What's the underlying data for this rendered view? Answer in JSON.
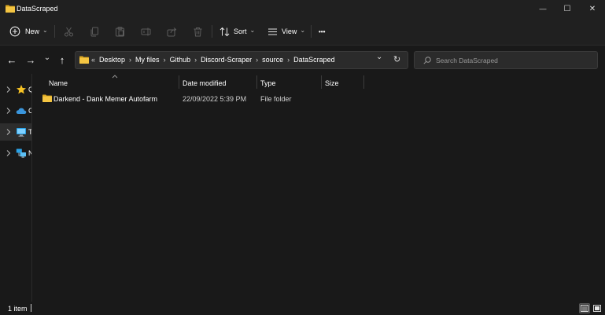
{
  "window": {
    "title": "DataScraped",
    "minimize_glyph": "—",
    "maximize_glyph": "☐",
    "close_glyph": "✕"
  },
  "toolbar": {
    "new_label": "New",
    "sort_label": "Sort",
    "view_label": "View",
    "more_glyph": "•••",
    "chevron_glyph": "⌄"
  },
  "nav": {
    "back_glyph": "←",
    "forward_glyph": "→",
    "recent_glyph": "⌄",
    "up_glyph": "↑"
  },
  "address": {
    "overflow_glyph": "«",
    "crumbs": [
      "Desktop",
      "My files",
      "Github",
      "Discord-Scraper",
      "source",
      "DataScraped"
    ],
    "sep_glyph": "›",
    "dropdown_glyph": "⌄",
    "refresh_glyph": "↻"
  },
  "search": {
    "placeholder": "Search DataScraped"
  },
  "sidebar": {
    "items": [
      {
        "icon": "star-icon",
        "label": "Q",
        "selected": false
      },
      {
        "icon": "cloud-icon",
        "label": "C",
        "selected": false
      },
      {
        "icon": "monitor-icon",
        "label": "T",
        "selected": true
      },
      {
        "icon": "network-icon",
        "label": "N",
        "selected": false
      }
    ]
  },
  "columns": {
    "name": "Name",
    "date": "Date modified",
    "type": "Type",
    "size": "Size"
  },
  "files": [
    {
      "name": "Darkend - Dank Memer Autofarm",
      "date": "22/09/2022 5:39 PM",
      "type": "File folder",
      "size": ""
    }
  ],
  "status": {
    "item_count": "1 item"
  },
  "colors": {
    "folder": "#f4c542",
    "folder_dark": "#d9a520",
    "accent": "#60cdff",
    "star": "#f7c325",
    "cloud": "#3a96dd"
  }
}
